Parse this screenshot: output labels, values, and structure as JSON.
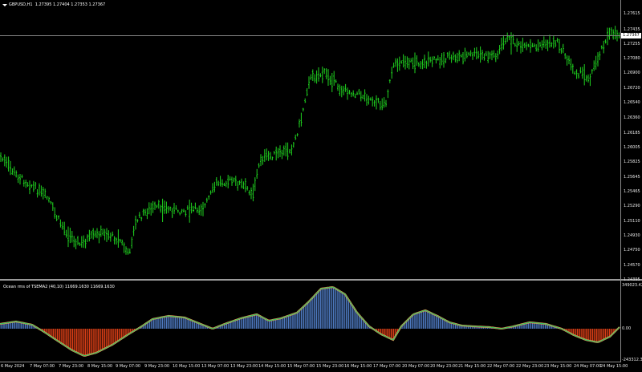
{
  "chart": {
    "symbol_label": "GBPUSD,H1",
    "ohlc_text": "1.27395 1.27404 1.27353 1.27367",
    "current_price": "1.27367",
    "price_ticks": [
      "1.27615",
      "1.27435",
      "1.27255",
      "1.27080",
      "1.26900",
      "1.26720",
      "1.26540",
      "1.26360",
      "1.26185",
      "1.26005",
      "1.25825",
      "1.25645",
      "1.25465",
      "1.25290",
      "1.25110",
      "1.24930",
      "1.24750",
      "1.24570",
      "1.24395"
    ],
    "indicator_title": "Ocean rms of TSEMA2 (40,10) 11669.1630 11669.1630",
    "indicator_ticks": [
      "349023.42",
      "0.00",
      "-243312.3"
    ],
    "time_ticks": [
      "6 May 2024",
      "7 May 07:00",
      "7 May 23:00",
      "8 May 15:00",
      "9 May 07:00",
      "9 May 23:00",
      "10 May 15:00",
      "13 May 07:00",
      "13 May 23:00",
      "14 May 15:00",
      "15 May 07:00",
      "15 May 23:00",
      "16 May 15:00",
      "17 May 07:00",
      "20 May 07:00",
      "20 May 23:00",
      "21 May 15:00",
      "22 May 07:00",
      "22 May 23:00",
      "23 May 15:00",
      "24 May 07:00",
      "24 May 15:00"
    ],
    "colors": {
      "bars": "#1fd21f",
      "histogram_positive": "#5b8ee0",
      "histogram_negative": "#ff4a1a",
      "signal_line": "#39c45f",
      "signal_line_alt": "#ff8a55"
    }
  }
}
